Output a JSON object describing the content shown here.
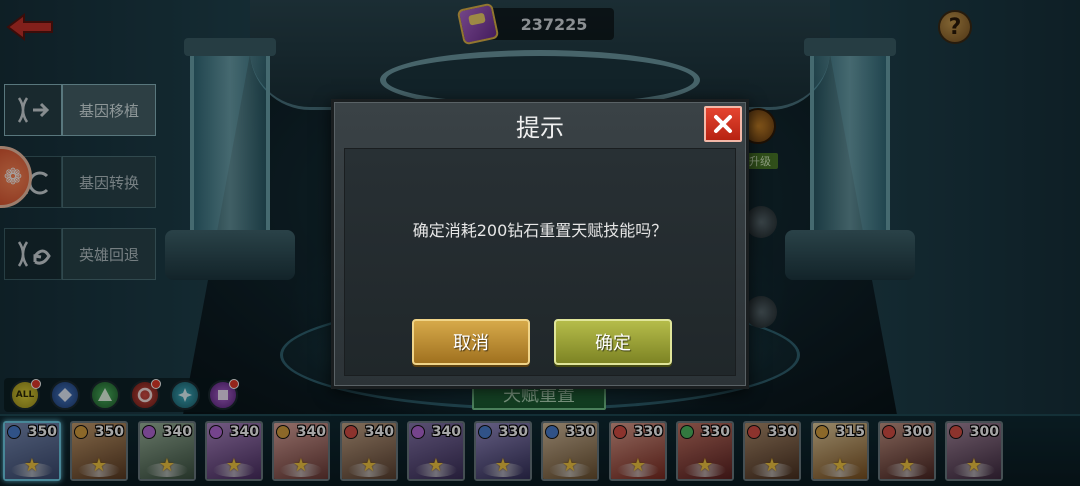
{
  "currency": {
    "value": "237225",
    "icon": "gem-chest-icon"
  },
  "topbar": {
    "back_icon": "back-arrow-icon",
    "help_label": "?"
  },
  "menu": {
    "items": [
      {
        "label": "基因移植",
        "icon": "dna-transplant-icon",
        "active": true
      },
      {
        "label": "基因转换",
        "icon": "dna-convert-icon",
        "active": false
      },
      {
        "label": "英雄回退",
        "icon": "dna-revert-icon",
        "active": false
      }
    ]
  },
  "background": {
    "tag_text": "升级",
    "talent_reset_label": "天赋重置"
  },
  "filters": [
    {
      "label": "ALL",
      "color": "#e4d63a",
      "badge": true
    },
    {
      "label": "",
      "color": "#4a7fd0",
      "badge": false
    },
    {
      "label": "",
      "color": "#4dbb62",
      "badge": false
    },
    {
      "label": "",
      "color": "#d84f45",
      "badge": true
    },
    {
      "label": "",
      "color": "#3fb5c8",
      "badge": false
    },
    {
      "label": "",
      "color": "#b469d8",
      "badge": true
    }
  ],
  "heroes": [
    {
      "power": "350",
      "faction_color": "#4a7fd0",
      "portrait": [
        "#7c8fb8",
        "#3b4a70"
      ],
      "selected": true
    },
    {
      "power": "350",
      "faction_color": "#d8a040",
      "portrait": [
        "#c9a070",
        "#5a3a22"
      ],
      "selected": false
    },
    {
      "power": "340",
      "faction_color": "#b469d8",
      "portrait": [
        "#9fb8a0",
        "#3a5040"
      ],
      "selected": false
    },
    {
      "power": "340",
      "faction_color": "#b469d8",
      "portrait": [
        "#b08ac8",
        "#4a2e62"
      ],
      "selected": false
    },
    {
      "power": "340",
      "faction_color": "#d8a040",
      "portrait": [
        "#e0a8a0",
        "#6a3a36"
      ],
      "selected": false
    },
    {
      "power": "340",
      "faction_color": "#d84f45",
      "portrait": [
        "#c8a88a",
        "#5a4030"
      ],
      "selected": false
    },
    {
      "power": "340",
      "faction_color": "#b469d8",
      "portrait": [
        "#8a7ab0",
        "#3a2e58"
      ],
      "selected": false
    },
    {
      "power": "330",
      "faction_color": "#4a7fd0",
      "portrait": [
        "#9a90c8",
        "#34305a"
      ],
      "selected": false
    },
    {
      "power": "330",
      "faction_color": "#4a7fd0",
      "portrait": [
        "#d8c0a0",
        "#6a5030"
      ],
      "selected": false
    },
    {
      "power": "330",
      "faction_color": "#d84f45",
      "portrait": [
        "#e0a090",
        "#7a2a20"
      ],
      "selected": false
    },
    {
      "power": "330",
      "faction_color": "#4dbb62",
      "portrait": [
        "#c87868",
        "#5a2020"
      ],
      "selected": false
    },
    {
      "power": "330",
      "faction_color": "#d84f45",
      "portrait": [
        "#b09070",
        "#4a3020"
      ],
      "selected": false
    },
    {
      "power": "315",
      "faction_color": "#d8a040",
      "portrait": [
        "#e8d0a0",
        "#7a5020"
      ],
      "selected": false
    },
    {
      "power": "300",
      "faction_color": "#d84f45",
      "portrait": [
        "#c89888",
        "#4a2622"
      ],
      "selected": false
    },
    {
      "power": "300",
      "faction_color": "#d84f45",
      "portrait": [
        "#a88aa0",
        "#3e2a40"
      ],
      "selected": false
    }
  ],
  "dialog": {
    "title": "提示",
    "message": "确定消耗200钻石重置天赋技能吗？",
    "cancel_label": "取消",
    "confirm_label": "确定",
    "close_icon": "close-icon"
  }
}
